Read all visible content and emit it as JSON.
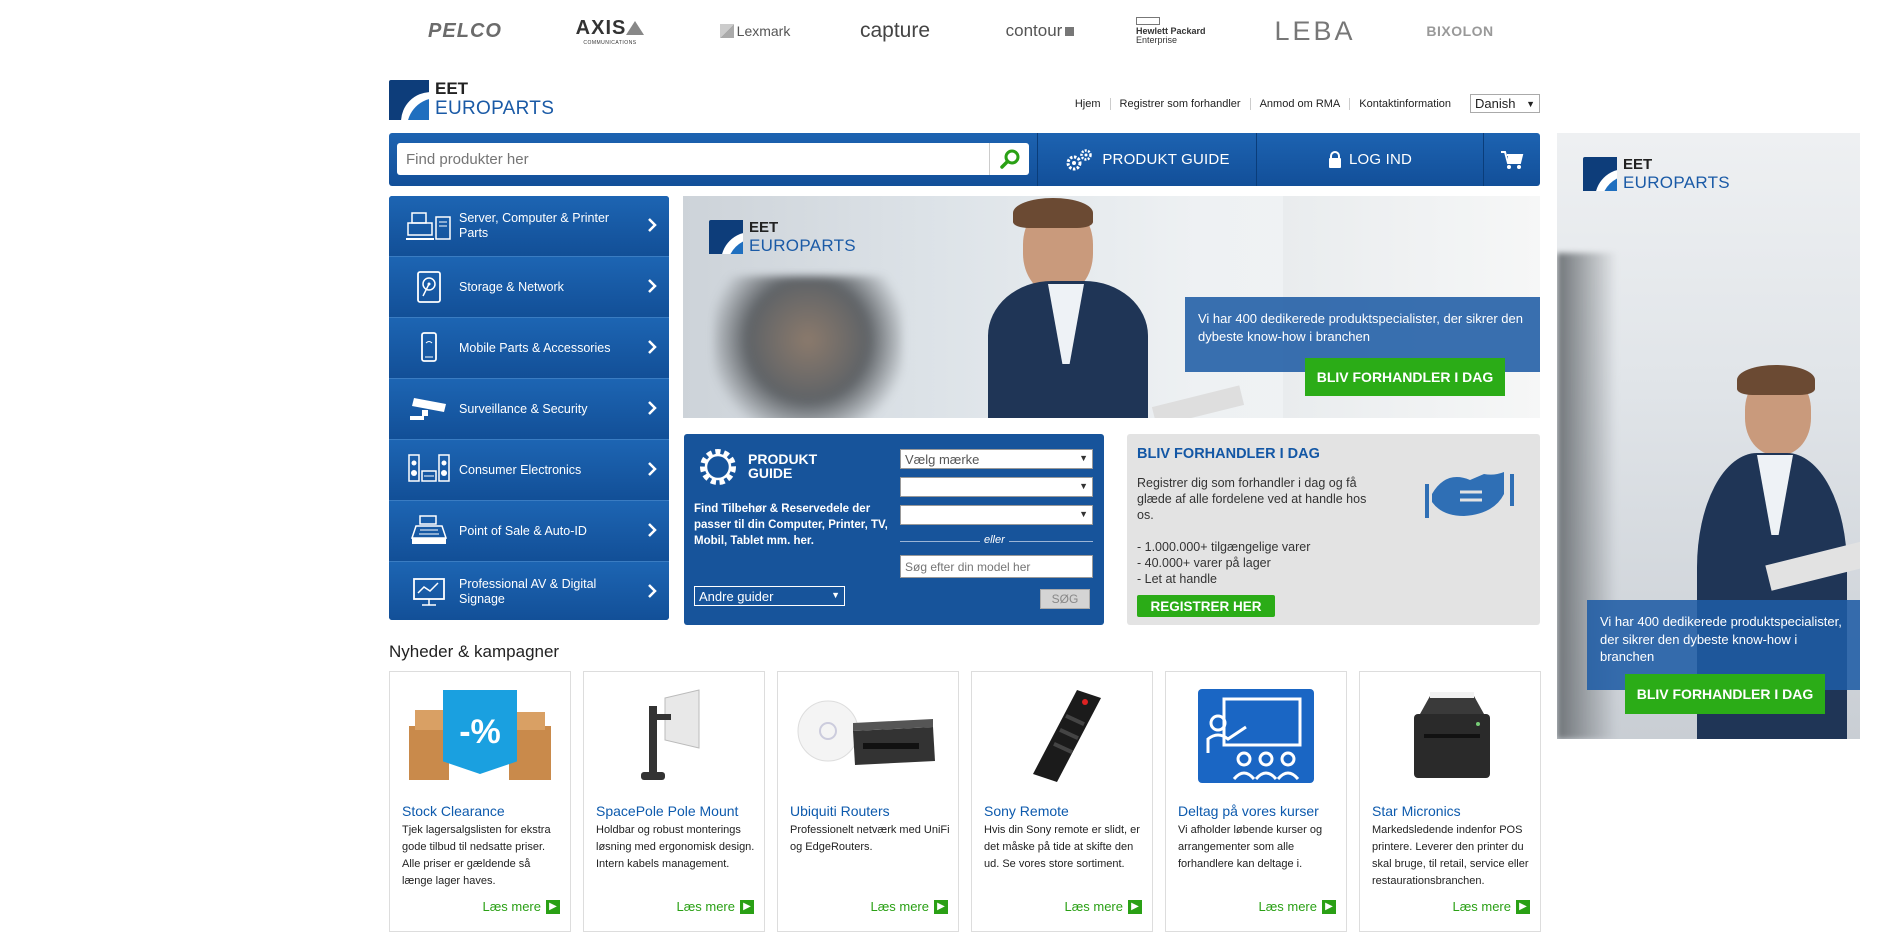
{
  "brands": [
    "PELCO",
    "AXIS",
    "Lexmark",
    "capture",
    "contour",
    "Hewlett Packard Enterprise",
    "LEBA",
    "BIXOLON"
  ],
  "brand_sub": {
    "axis": "COMMUNICATIONS",
    "hpe_line1": "Hewlett Packard",
    "hpe_line2": "Enterprise"
  },
  "logo": {
    "line1": "EET",
    "line2": "EUROPARTS"
  },
  "topnav": [
    "Hjem",
    "Registrer som forhandler",
    "Anmod om RMA",
    "Kontaktinformation"
  ],
  "language": "Danish",
  "search": {
    "placeholder": "Find produkter her"
  },
  "toolbar": {
    "guide_label": "PRODUKT GUIDE",
    "login_label": "LOG IND"
  },
  "sidebar": {
    "items": [
      {
        "label": "Server, Computer & Printer Parts",
        "icon": "server-icon"
      },
      {
        "label": "Storage & Network",
        "icon": "harddisk-icon"
      },
      {
        "label": "Mobile Parts & Accessories",
        "icon": "mobile-icon"
      },
      {
        "label": "Surveillance & Security",
        "icon": "camera-icon"
      },
      {
        "label": "Consumer Electronics",
        "icon": "speaker-icon"
      },
      {
        "label": "Point of Sale & Auto-ID",
        "icon": "cash-register-icon"
      },
      {
        "label": "Professional AV & Digital Signage",
        "icon": "presentation-icon"
      }
    ]
  },
  "hero": {
    "text": "Vi har 400 dedikerede produktspecialister, der sikrer den dybeste know-how i branchen",
    "cta": "BLIV FORHANDLER I DAG"
  },
  "guide": {
    "title_1": "PRODUKT",
    "title_2": "GUIDE",
    "description": "Find Tilbehør & Reservedele der passer til din Computer, Printer, TV, Mobil, Tablet mm. her.",
    "brand_select": "Vælg mærke",
    "select_2": "",
    "select_3": "",
    "or": "eller",
    "model_placeholder": "Søg efter din model her",
    "search_btn": "SØG",
    "other_guides": "Andre guider"
  },
  "register": {
    "title": "BLIV FORHANDLER I DAG",
    "text": "Registrer dig som forhandler i dag og få glæde af alle fordelene ved at handle hos os.",
    "bullets": [
      "- 1.000.000+ tilgængelige varer",
      "- 40.000+ varer på lager",
      "- Let at handle"
    ],
    "cta": "REGISTRER HER"
  },
  "news": {
    "title": "Nyheder & kampagner",
    "more_label": "Læs mere",
    "cards": [
      {
        "title": "Stock Clearance",
        "text": "Tjek lagersalgslisten for ekstra gode tilbud til nedsatte priser. Alle priser er gældende så længe lager haves.",
        "badge": "-%"
      },
      {
        "title": "SpacePole Pole Mount",
        "text": "Holdbar og robust monterings løsning med ergonomisk design. Intern kabels management."
      },
      {
        "title": "Ubiquiti Routers",
        "text": "Professionelt netværk med UniFi og EdgeRouters."
      },
      {
        "title": "Sony Remote",
        "text": "Hvis din Sony remote er slidt, er det måske på tide at skifte den ud. Se vores store sortiment."
      },
      {
        "title": "Deltag på vores kurser",
        "text": "Vi afholder løbende kurser og arrangementer som alle forhandlere kan deltage i."
      },
      {
        "title": "Star Micronics",
        "text": "Markedsledende indenfor POS printere. Leverer den printer du skal bruge, til retail, service eller restaurationsbranchen."
      }
    ]
  },
  "side_banner": {
    "text": "Vi har 400 dedikerede produktspecialister, der sikrer den dybeste know-how i branchen",
    "cta": "BLIV FORHANDLER I DAG"
  },
  "colors": {
    "primary": "#17589f",
    "green": "#2bac17",
    "link": "#0d5aad"
  }
}
